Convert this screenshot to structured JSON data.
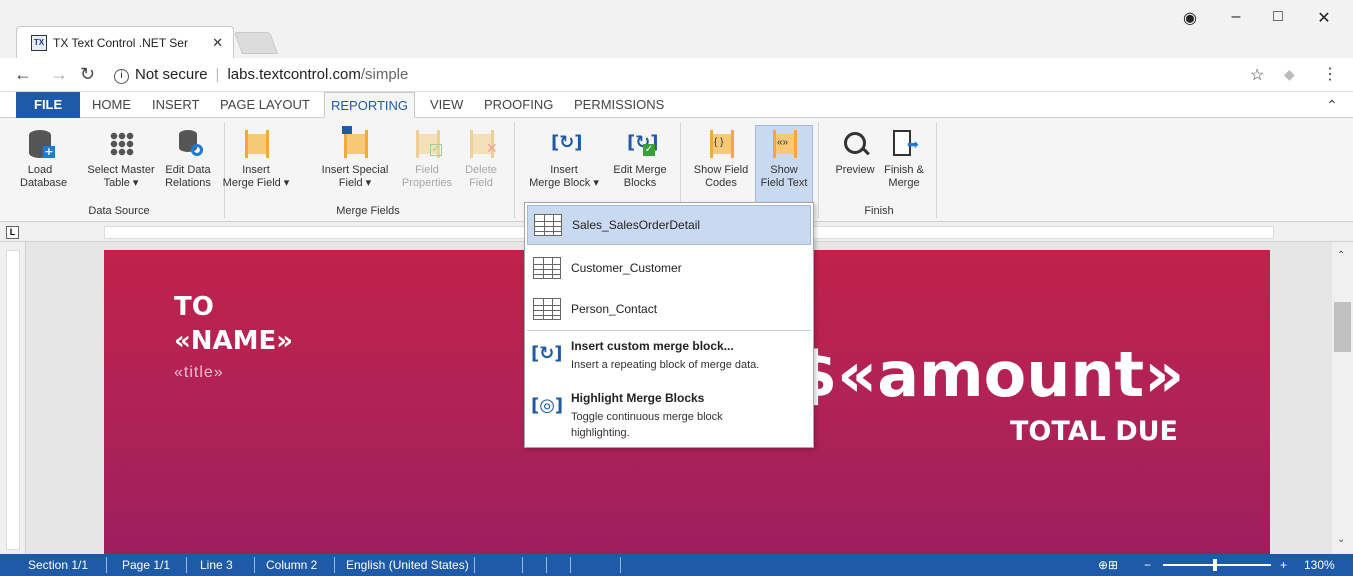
{
  "browser": {
    "tab_title": "TX Text Control .NET Ser",
    "favicon": "TX",
    "url_security": "Not secure",
    "url_host": "labs.textcontrol.com",
    "url_path": "/simple"
  },
  "ribbon_tabs": [
    "FILE",
    "HOME",
    "INSERT",
    "PAGE LAYOUT",
    "REPORTING",
    "VIEW",
    "PROOFING",
    "PERMISSIONS"
  ],
  "active_tab": "REPORTING",
  "groups": {
    "data_source": "Data Source",
    "merge_fields": "Merge Fields",
    "finish": "Finish"
  },
  "buttons": {
    "load_db": [
      "Load",
      "Database"
    ],
    "select_master": [
      "Select Master",
      "Table ▾"
    ],
    "edit_relations": [
      "Edit Data",
      "Relations"
    ],
    "insert_merge_field": [
      "Insert",
      "Merge Field ▾"
    ],
    "insert_special": [
      "Insert Special",
      "Field ▾"
    ],
    "field_props": [
      "Field",
      "Properties"
    ],
    "delete_field": [
      "Delete",
      "Field"
    ],
    "insert_block": [
      "Insert",
      "Merge Block ▾"
    ],
    "edit_blocks": [
      "Edit Merge",
      "Blocks"
    ],
    "show_codes": [
      "Show Field",
      "Codes"
    ],
    "show_text": [
      "Show",
      "Field Text"
    ],
    "preview": [
      "Preview",
      ""
    ],
    "finish_merge": [
      "Finish &",
      "Merge"
    ]
  },
  "dropdown": {
    "tables": [
      "Sales_SalesOrderDetail",
      "Customer_Customer",
      "Person_Contact"
    ],
    "custom_head": "Insert custom merge block...",
    "custom_desc": "Insert a repeating block of merge data.",
    "highlight_head": "Highlight Merge Blocks",
    "highlight_desc": "Toggle continuous merge block highlighting."
  },
  "document": {
    "to": "TO",
    "name": "«NAME»",
    "title": "«title»",
    "amount": "$«amount»",
    "total_due": "TOTAL DUE"
  },
  "status": {
    "section": "Section 1/1",
    "page": "Page 1/1",
    "line": "Line 3",
    "column": "Column 2",
    "language": "English (United States)",
    "zoom": "130%",
    "zoom_minus": "−",
    "zoom_plus": "+"
  },
  "colors": {
    "accent": "#1e5aa8",
    "doc_top": "#c0224a",
    "doc_bottom": "#9a1e5e"
  }
}
